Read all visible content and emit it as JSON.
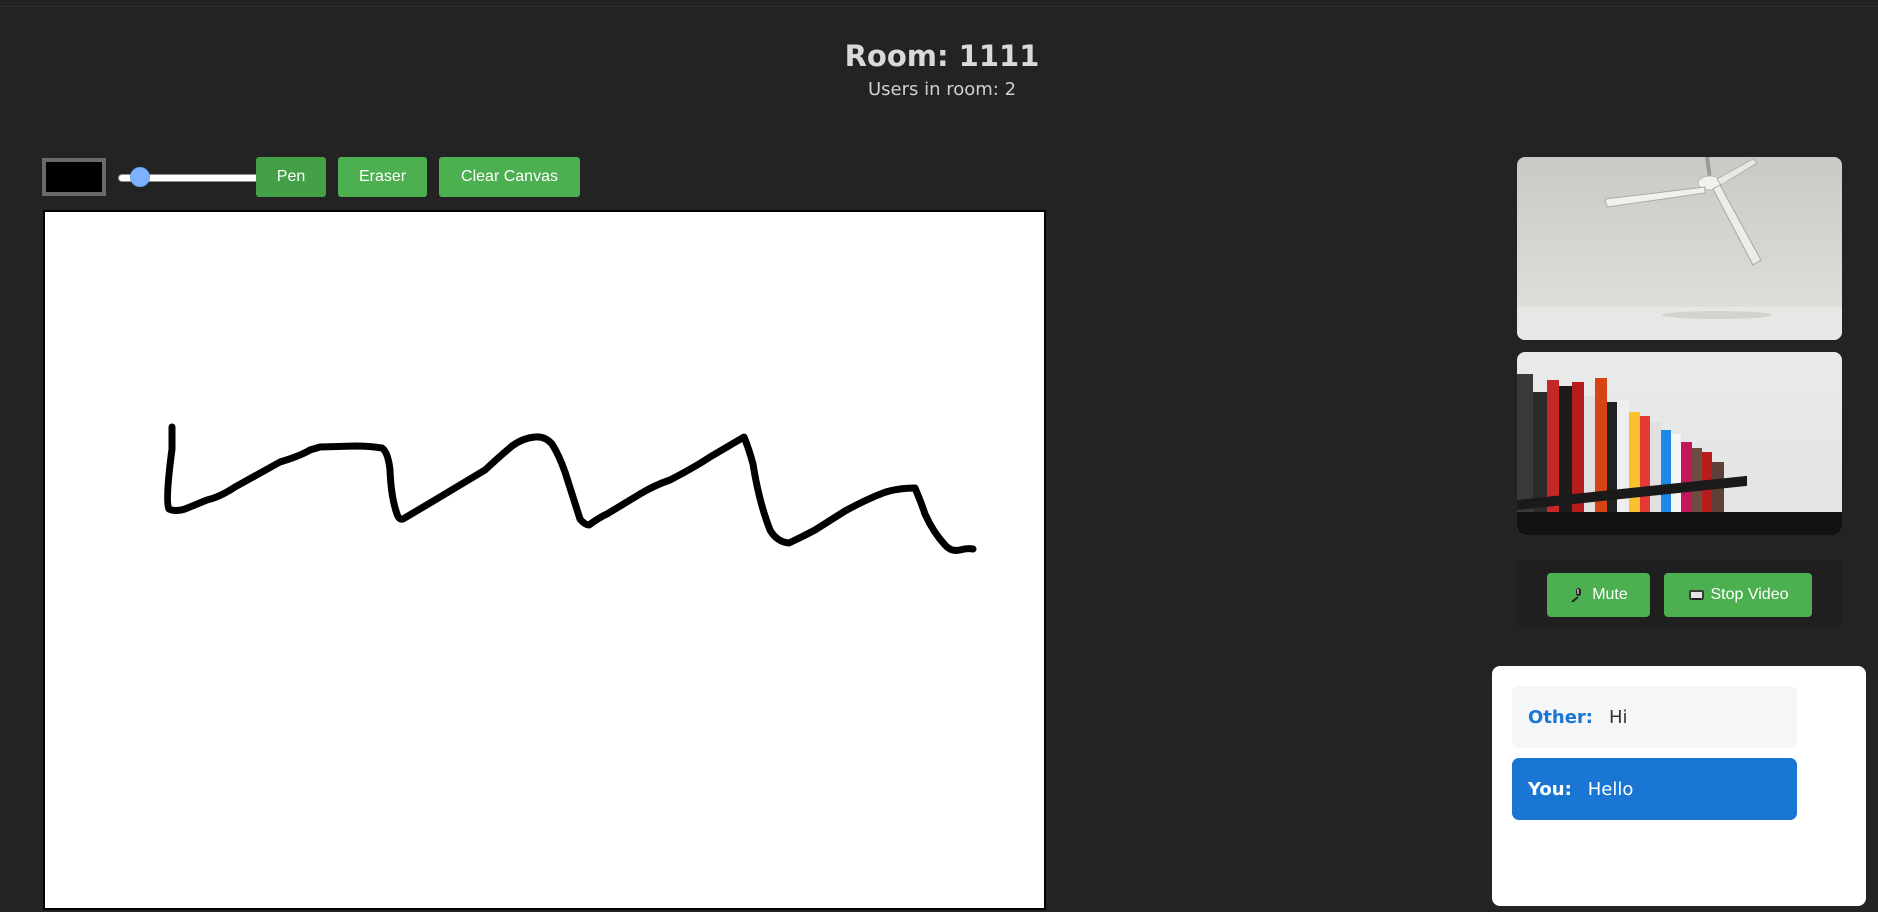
{
  "header": {
    "room_label": "Room: 1111",
    "users_label": "Users in room: 2"
  },
  "toolbar": {
    "color_value": "#000000",
    "pen_label": "Pen",
    "eraser_label": "Eraser",
    "clear_label": "Clear Canvas",
    "brush_size_fraction": 0.08
  },
  "canvas": {
    "background": "#ffffff",
    "stroke_color": "#000000"
  },
  "media": {
    "mute_label": "Mute",
    "stop_video_label": "Stop Video",
    "mute_icon": "microphone-icon",
    "video_icon": "camera-icon"
  },
  "chat": {
    "messages": [
      {
        "sender": "Other:",
        "text": "Hi"
      },
      {
        "sender": "You:",
        "text": "Hello"
      }
    ]
  },
  "colors": {
    "background": "#232323",
    "button_green": "#4caf50",
    "chat_accent": "#1976d2"
  }
}
